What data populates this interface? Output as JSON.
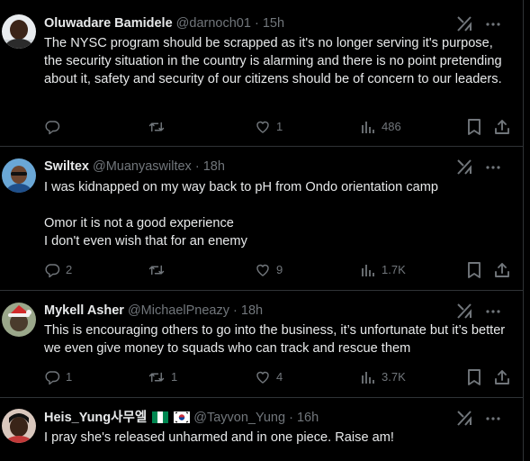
{
  "colors": {
    "background": "#000000",
    "text": "#e7e9ea",
    "secondary": "#71767b",
    "divider": "#2f3336"
  },
  "tweets": [
    {
      "name": "Oluwadare Bamidele",
      "handle": "@darnoch01",
      "separator": "·",
      "time": "15h",
      "text_lines": [
        "The NYSC program should be scrapped as it's no longer serving it's purpose, the security situation in the country is alarming and there is no point pretending about it, safety and security of our citizens should be of concern to our leaders."
      ],
      "replies": "",
      "retweets": "",
      "likes": "1",
      "views": "486",
      "icons": [
        "grok-icon",
        "more-icon",
        "reply-icon",
        "retweet-icon",
        "like-icon",
        "views-icon",
        "bookmark-icon",
        "share-icon"
      ]
    },
    {
      "name": "Swiltex",
      "handle": "@Muanyaswiltex",
      "separator": "·",
      "time": "18h",
      "text_lines": [
        "I was kidnapped on my way back to pH from  Ondo  orientation camp",
        "Omor it is not a good experience",
        "I don't even wish that for an enemy"
      ],
      "replies": "2",
      "retweets": "",
      "likes": "9",
      "views": "1.7K",
      "icons": [
        "grok-icon",
        "more-icon",
        "reply-icon",
        "retweet-icon",
        "like-icon",
        "views-icon",
        "bookmark-icon",
        "share-icon"
      ]
    },
    {
      "name": "Mykell Asher",
      "handle": "@MichaelPneazy",
      "separator": "·",
      "time": "18h",
      "text_lines": [
        "This is encouraging others to go into the business, it’s unfortunate but it’s better we even give money to squads who can track and rescue them"
      ],
      "replies": "1",
      "retweets": "1",
      "likes": "4",
      "views": "3.7K",
      "icons": [
        "grok-icon",
        "more-icon",
        "reply-icon",
        "retweet-icon",
        "like-icon",
        "views-icon",
        "bookmark-icon",
        "share-icon"
      ]
    },
    {
      "name": "Heis_Yung사무엘",
      "handle": "@Tayvon_Yung",
      "separator": "·",
      "time": "16h",
      "text_lines": [
        "I pray she's released unharmed and in one piece. Raise am!"
      ],
      "flags": [
        "nigeria-flag-icon",
        "south-korea-flag-icon"
      ],
      "icons": [
        "grok-icon",
        "more-icon"
      ]
    }
  ]
}
